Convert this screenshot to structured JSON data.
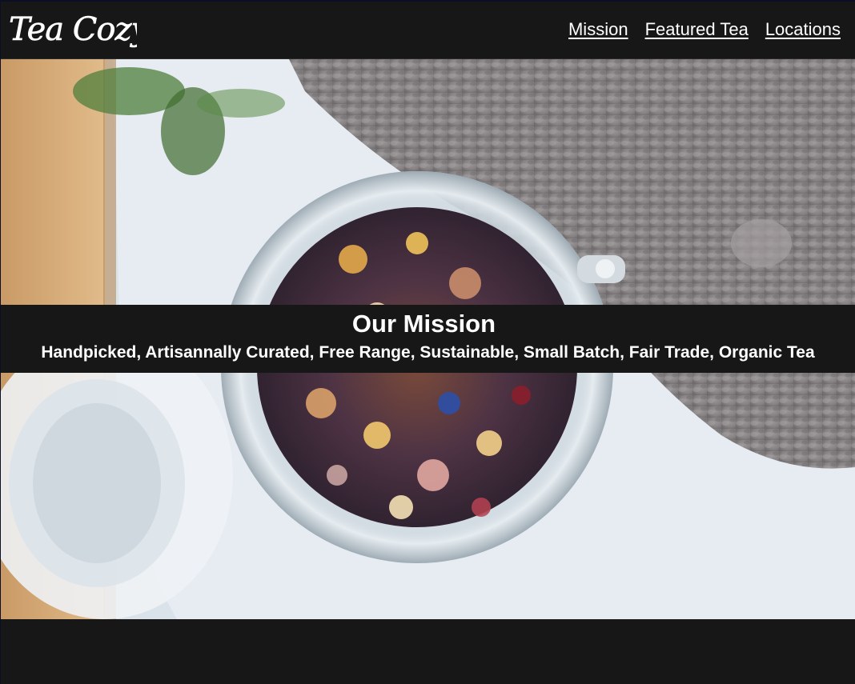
{
  "site": {
    "logo_text": "Tea Cozy"
  },
  "nav": {
    "items": [
      {
        "label": "Mission"
      },
      {
        "label": "Featured Tea"
      },
      {
        "label": "Locations"
      }
    ]
  },
  "mission": {
    "title": "Our Mission",
    "subtitle": "Handpicked, Artisannally Curated, Free Range, Sustainable, Small Batch, Fair Trade, Organic Tea"
  },
  "hero_image": {
    "subject": "open glass jar of loose leaf tea with dried flowers beside a knitted grey cozy"
  },
  "colors": {
    "background": "#171717",
    "text": "#ffffff"
  }
}
